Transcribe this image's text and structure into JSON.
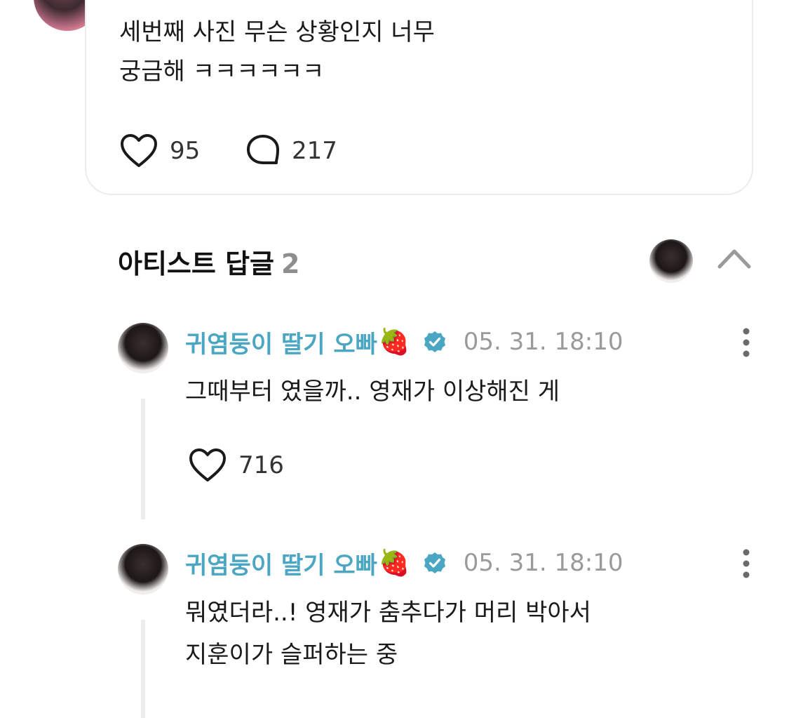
{
  "post": {
    "text": "세번째 사진 무슨 상황인지 너무\n궁금해 ㅋㅋㅋㅋㅋㅋ",
    "likes": "95",
    "comments": "217",
    "like_icon": "heart-icon",
    "comment_icon": "comment-bubble-icon"
  },
  "artist_replies": {
    "title": "아티스트 답글",
    "count": "2",
    "collapse_icon": "chevron-up-icon"
  },
  "replies": [
    {
      "name": "귀염둥이 딸기 오빠",
      "emoji": "🍓",
      "time": "05. 31. 18:10",
      "text": "그때부터 였을까.. 영재가 이상해진 게",
      "likes": "716"
    },
    {
      "name": "귀염둥이 딸기 오빠",
      "emoji": "🍓",
      "time": "05. 31. 18:10",
      "text": "뭐였더라..! 영재가 춤추다가 머리 박아서\n지훈이가 슬퍼하는 중"
    }
  ],
  "colors": {
    "artist_name": "#4aa6c2",
    "verified_badge": "#4aa6c2",
    "muted": "#9a9a9a"
  }
}
